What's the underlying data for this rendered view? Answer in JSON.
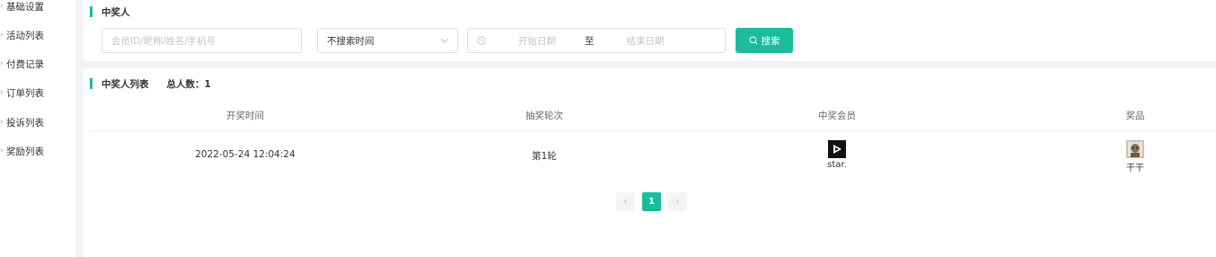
{
  "sidebar": {
    "items": [
      {
        "label": "基础设置"
      },
      {
        "label": "活动列表"
      },
      {
        "label": "付费记录"
      },
      {
        "label": "订单列表"
      },
      {
        "label": "投诉列表"
      },
      {
        "label": "奖励列表"
      }
    ]
  },
  "filter": {
    "title": "中奖人",
    "search_placeholder": "会员ID/昵称/姓名/手机号",
    "time_select_value": "不搜索时间",
    "start_date_placeholder": "开始日期",
    "date_separator": "至",
    "end_date_placeholder": "结束日期",
    "search_button_label": "搜索"
  },
  "list": {
    "title": "中奖人列表",
    "total_label": "总人数：1",
    "columns": [
      "开奖时间",
      "抽奖轮次",
      "中奖会员",
      "奖品"
    ],
    "rows": [
      {
        "draw_time": "2022-05-24 12:04:24",
        "round": "第1轮",
        "member_name": "star.",
        "prize_name": "干干"
      }
    ]
  },
  "pagination": {
    "prev": "‹",
    "current_page": "1",
    "next": "›"
  },
  "colors": {
    "accent": "#1abc9c"
  }
}
